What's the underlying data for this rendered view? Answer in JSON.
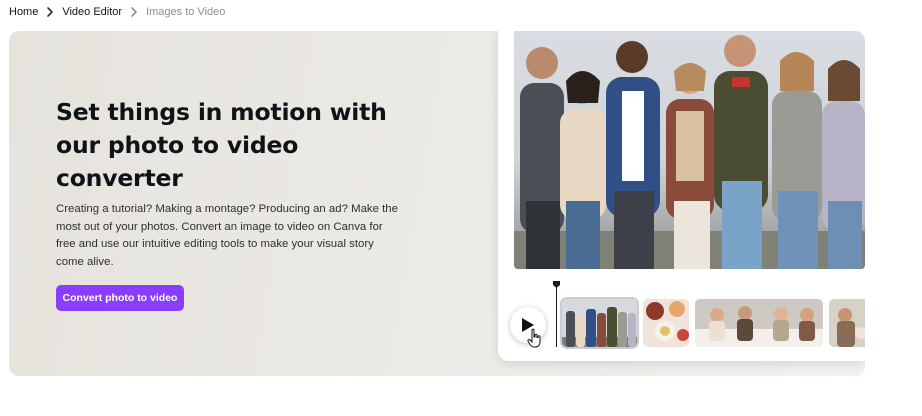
{
  "breadcrumb": {
    "items": [
      {
        "label": "Home"
      },
      {
        "label": "Video Editor"
      },
      {
        "label": "Images to Video"
      }
    ]
  },
  "hero": {
    "title": "Set things in motion with our photo to video converter",
    "description": "Creating a tutorial? Making a montage? Producing an ad? Make the most out of your photos. Convert an image to video on Canva for free and use our intuitive editing tools to make your visual story come alive.",
    "cta_label": "Convert photo to video"
  },
  "mockup": {
    "icons": {
      "play": "play-icon",
      "cursor": "hand-cursor-icon",
      "playhead": "playhead-icon"
    }
  },
  "colors": {
    "accent": "#8b3dff",
    "hero_bg": "#ebe9e4"
  }
}
